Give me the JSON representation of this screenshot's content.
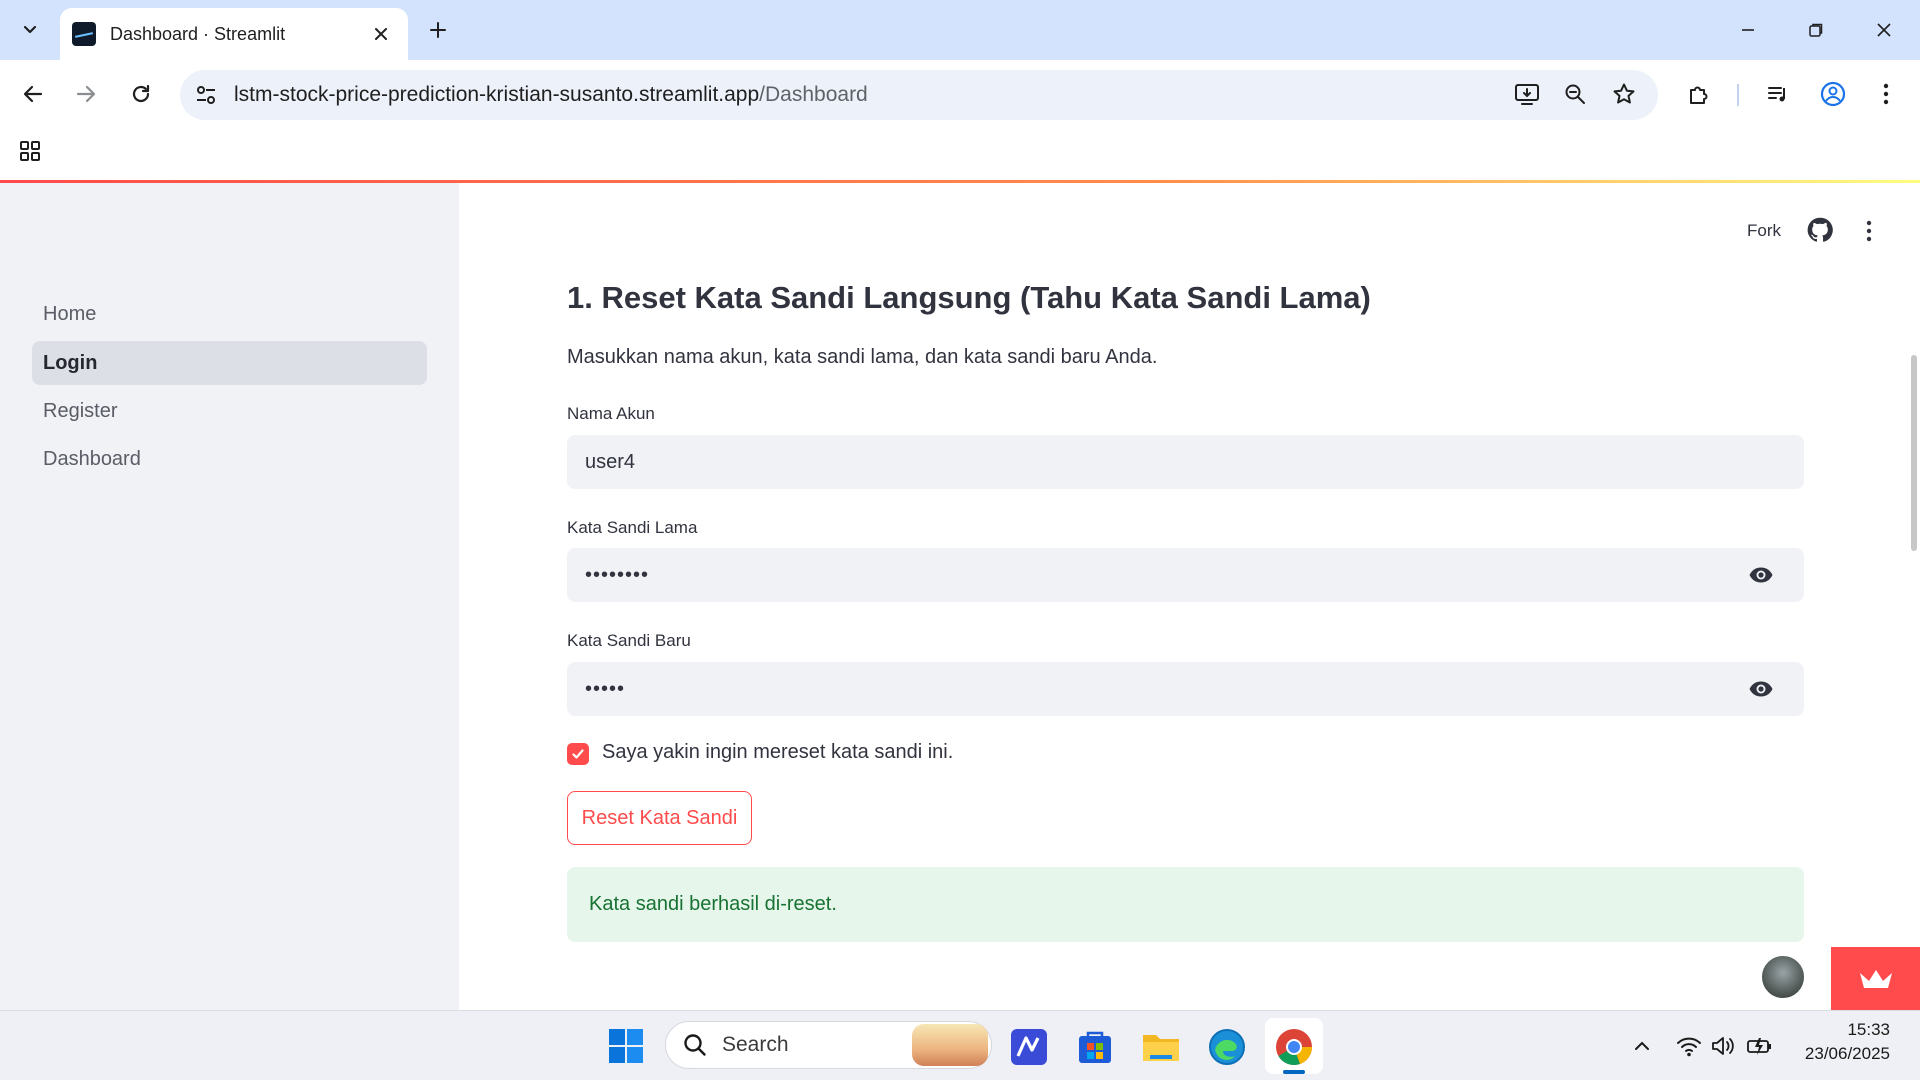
{
  "browser": {
    "tab_title": "Dashboard · Streamlit",
    "url_host": "lstm-stock-price-prediction-kristian-susanto.streamlit.app",
    "url_path": "/Dashboard"
  },
  "sidebar": {
    "items": [
      {
        "label": "Home",
        "active": false
      },
      {
        "label": "Login",
        "active": true
      },
      {
        "label": "Register",
        "active": false
      },
      {
        "label": "Dashboard",
        "active": false
      }
    ]
  },
  "header": {
    "fork_label": "Fork"
  },
  "main": {
    "heading": "1. Reset Kata Sandi Langsung (Tahu Kata Sandi Lama)",
    "subtext": "Masukkan nama akun, kata sandi lama, dan kata sandi baru Anda.",
    "fields": {
      "username": {
        "label": "Nama Akun",
        "value": "user4"
      },
      "old_password": {
        "label": "Kata Sandi Lama",
        "value": "••••••••"
      },
      "new_password": {
        "label": "Kata Sandi Baru",
        "value": "•••••"
      }
    },
    "confirm_checkbox": {
      "label": "Saya yakin ingin mereset kata sandi ini.",
      "checked": true
    },
    "reset_button": "Reset Kata Sandi",
    "success_message": "Kata sandi berhasil di-reset."
  },
  "taskbar": {
    "search_placeholder": "Search",
    "time": "15:33",
    "date": "23/06/2025"
  },
  "colors": {
    "accent": "#ff4b4b",
    "sidebar_bg": "#f0f2f6",
    "success_bg": "#e6f6ea",
    "success_text": "#177233",
    "tabbar_bg": "#d3e3fd"
  }
}
